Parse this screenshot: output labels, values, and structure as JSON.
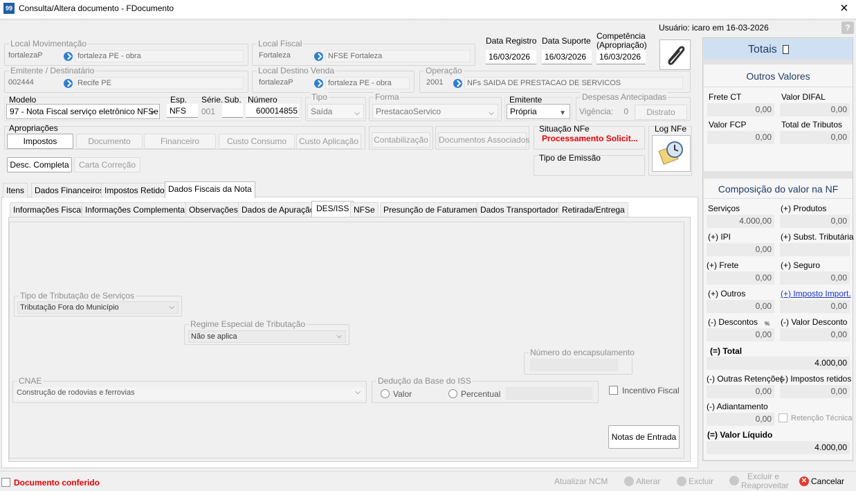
{
  "window": {
    "title": "Consulta/Altera documento - FDocumento",
    "app_icon": "99",
    "close": "×"
  },
  "user_line": "Usuário: icaro em 16-03-2026",
  "help": "?",
  "local_mov": {
    "label": "Local Movimentação",
    "code": "fortalezaP",
    "name": "fortaleza PE - obra"
  },
  "local_fiscal": {
    "label": "Local Fiscal",
    "code": "Fortaleza",
    "name": "NFSE Fortaleza"
  },
  "data_registro": {
    "label": "Data Registro",
    "value": "16/03/2026"
  },
  "data_suporte": {
    "label": "Data Suporte",
    "value": "16/03/2026"
  },
  "competencia": {
    "label": "Competência (Apropriação)",
    "value": "16/03/2026"
  },
  "emitente_dest": {
    "label": "Emitente / Destinatário",
    "code": "002444",
    "name": "Recife PE"
  },
  "local_destino": {
    "label": "Local Destino Venda",
    "code": "fortalezaP",
    "name": "fortaleza PE - obra"
  },
  "operacao": {
    "label": "Operação",
    "code": "2001",
    "name": "NFs SAIDA DE PRESTACAO DE SERVICOS"
  },
  "modelo": {
    "label": "Modelo",
    "value": "97 - Nota Fiscal serviço eletrônico NFSe"
  },
  "esp": {
    "label": "Esp.",
    "value": "NFS"
  },
  "serie": {
    "label": "Série.",
    "value": "001"
  },
  "sub": {
    "label": "Sub.",
    "value": ""
  },
  "numero": {
    "label": "Número",
    "value": "600014855"
  },
  "tipo": {
    "label": "Tipo",
    "value": "Saída"
  },
  "forma": {
    "label": "Forma",
    "value": "PrestacaoServico"
  },
  "emitente": {
    "label": "Emitente",
    "value": "Própria"
  },
  "despesas": {
    "label": "Despesas Antecipadas",
    "vigencia_label": "Vigência:",
    "vigencia_value": "0",
    "distrato": "Distrato"
  },
  "apropriacoes": {
    "label": "Apropriações",
    "buttons": [
      "Impostos",
      "Documento",
      "Financeiro",
      "Custo Consumo",
      "Custo Aplicação"
    ]
  },
  "contabilizacao": "Contabilização",
  "docs_associados": "Documentos Associados",
  "situacao": {
    "label": "Situação NFe",
    "value": "Processamento Solicit..."
  },
  "tipo_emissao": {
    "label": "Tipo de Emissão"
  },
  "log_nfe": "Log NFe",
  "desc_completa": "Desc. Completa",
  "carta_correcao": "Carta Correção",
  "tabs": [
    "Itens",
    "Dados Financeiros",
    "Impostos Retidos",
    "Dados Fiscais da Nota"
  ],
  "subtabs": [
    "Informações Fiscais",
    "Informações Complementares",
    "Observações",
    "Dados de Apuração",
    "DES/ISS",
    "NFSe",
    "Presunção de Faturamento",
    "Dados Transportadora",
    "Retirada/Entrega"
  ],
  "des": {
    "tipo_trib": {
      "label": "Tipo de Tributação de Serviços",
      "value": "Tributação Fora do Município"
    },
    "regime": {
      "label": "Regime Especial de Tributação",
      "value": "Não se aplica"
    },
    "encaps": {
      "label": "Número do encapsulamento",
      "value": ""
    },
    "cnae": {
      "label": "CNAE",
      "value": "Construção de rodovias e ferrovias"
    },
    "deducao": {
      "label": "Dedução da Base do ISS",
      "valor": "Valor",
      "percentual": "Percentual"
    },
    "incentivo": "Incentivo Fiscal",
    "notas_entrada": "Notas de Entrada"
  },
  "totais": {
    "title": "Totais",
    "outros_title": "Outros Valores",
    "frete_ct": {
      "label": "Frete CT",
      "value": "0,00"
    },
    "difal": {
      "label": "Valor DIFAL",
      "value": "0,00"
    },
    "fcp": {
      "label": "Valor FCP",
      "value": "0,00"
    },
    "total_trib": {
      "label": "Total de Tributos",
      "value": "0,00"
    },
    "comp_title": "Composição do valor na NF",
    "servicos": {
      "label": "Serviços",
      "value": "4.000,00"
    },
    "produtos": {
      "label": "(+) Produtos",
      "value": "0,00"
    },
    "ipi": {
      "label": "(+) IPI",
      "value": "0,00"
    },
    "subst": {
      "label": "(+) Subst. Tributária",
      "value": ""
    },
    "frete": {
      "label": "(+) Frete",
      "value": "0,00"
    },
    "seguro": {
      "label": "(+) Seguro",
      "value": "0,00"
    },
    "outros": {
      "label": "(+) Outros",
      "value": "0,00"
    },
    "imp_import": {
      "label": "(+) Imposto Import.",
      "value": "0,00"
    },
    "descontos": {
      "label": "(-) Descontos",
      "value": "0,00",
      "mark": "%"
    },
    "valor_desc": {
      "label": "(-) Valor Desconto",
      "value": "0,00"
    },
    "total": {
      "label": "(=) Total",
      "value": "4.000,00"
    },
    "outras_ret": {
      "label": "(-) Outras Retenções",
      "value": "0,00"
    },
    "imp_retidos": {
      "label": "(-) Impostos retidos",
      "value": "0,00"
    },
    "adiantamento": {
      "label": "(-) Adiantamento",
      "value": "0,00"
    },
    "retencao_tecnica": "Retenção Técnica",
    "liquido": {
      "label": "(=) Valor Líquido",
      "value": "4.000,00"
    }
  },
  "footer": {
    "conferido": "Documento conferido",
    "atualizar_ncm": "Atualizar NCM",
    "alterar": "Alterar",
    "excluir": "Excluir",
    "excluir_reap": "Excluir e Reaproveitar",
    "cancelar": "Cancelar"
  }
}
